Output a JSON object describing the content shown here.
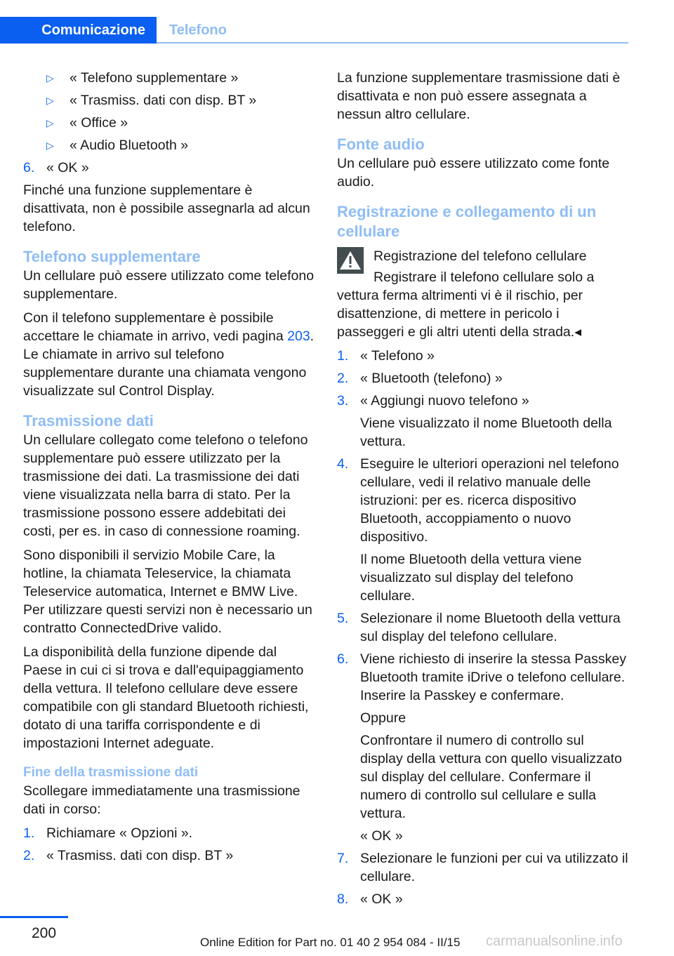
{
  "header": {
    "chapter": "Comunicazione",
    "section": "Telefono"
  },
  "left": {
    "bullets": [
      "« Telefono supplementare »",
      "« Trasmiss. dati con disp. BT »",
      "« Office »",
      "« Audio Bluetooth »"
    ],
    "step6": {
      "num": "6.",
      "text": "« OK »"
    },
    "note": "Finché una funzione supplementare è disattivata, non è possibile assegnarla ad alcun telefono.",
    "h_telefono": "Telefono supplementare",
    "p1": "Un cellulare può essere utilizzato come telefono supplementare.",
    "p2_pre": "Con il telefono supplementare è possibile accettare le chiamate in arrivo, vedi pagina ",
    "p2_link": "203",
    "p2_post": ". Le chiamate in arrivo sul telefono supplementare durante una chiamata vengono visualizzate sul Control Display.",
    "h_trasm": "Trasmissione dati",
    "p3": "Un cellulare collegato come telefono o telefono supplementare può essere utilizzato per la trasmissione dei dati. La trasmissione dei dati viene visualizzata nella barra di stato. Per la trasmissione possono essere addebitati dei costi, per es. in caso di connessione roaming.",
    "p4": "Sono disponibili il servizio Mobile Care, la hotline, la chiamata Teleservice, la chiamata Teleservice automatica, Internet e BMW Live. Per utilizzare questi servizi non è necessario un contratto ConnectedDrive valido.",
    "p5": "La disponibilità della funzione dipende dal Paese in cui ci si trova e dall'equipaggiamento della vettura. Il telefono cellulare deve essere compatibile con gli standard Bluetooth richiesti, dotato di una tariffa corrispondente e di impostazioni Internet adeguate.",
    "h_fine": "Fine della trasmissione dati",
    "p6": "Scollegare immediatamente una trasmissione dati in corso:",
    "steps": [
      {
        "num": "1.",
        "text": "Richiamare « Opzioni »."
      },
      {
        "num": "2.",
        "text": "« Trasmiss. dati con disp. BT »"
      }
    ]
  },
  "right": {
    "p1": "La funzione supplementare trasmissione dati è disattivata e non può essere assegnata a nessun altro cellulare.",
    "h_fonte": "Fonte audio",
    "p2": "Un cellulare può essere utilizzato come fonte audio.",
    "h_reg": "Registrazione e collegamento di un cellulare",
    "warn_title": "Registrazione del telefono cellulare",
    "warn_text": "Registrare il telefono cellulare solo a vettura ferma altrimenti vi è il rischio, per disattenzione, di mettere in pericolo i passeggeri e gli altri utenti della strada.◂",
    "steps": [
      {
        "num": "1.",
        "text": "« Telefono »"
      },
      {
        "num": "2.",
        "text": "« Bluetooth (telefono) »"
      },
      {
        "num": "3.",
        "text": "« Aggiungi nuovo telefono »",
        "sub": [
          "Viene visualizzato il nome Bluetooth della vettura."
        ]
      },
      {
        "num": "4.",
        "text": "Eseguire le ulteriori operazioni nel telefono cellulare, vedi il relativo manuale delle istruzioni: per es. ricerca dispositivo Bluetooth, accoppiamento o nuovo dispositivo.",
        "sub": [
          "Il nome Bluetooth della vettura viene visualizzato sul display del telefono cellulare."
        ]
      },
      {
        "num": "5.",
        "text": "Selezionare il nome Bluetooth della vettura sul display del telefono cellulare."
      },
      {
        "num": "6.",
        "text": "Viene richiesto di inserire la stessa Passkey Bluetooth tramite iDrive o telefono cellulare. Inserire la Passkey e confermare.",
        "sub": [
          "Oppure",
          "Confrontare il numero di controllo sul display della vettura con quello visualizzato sul display del cellulare. Confermare il numero di controllo sul cellulare e sulla vettura.",
          "« OK »"
        ]
      },
      {
        "num": "7.",
        "text": "Selezionare le funzioni per cui va utilizzato il cellulare."
      },
      {
        "num": "8.",
        "text": "« OK »"
      }
    ]
  },
  "footer": {
    "page": "200",
    "edition": "Online Edition for Part no. 01 40 2 954 084 - II/15",
    "watermark": "carmanualsonline.info"
  }
}
